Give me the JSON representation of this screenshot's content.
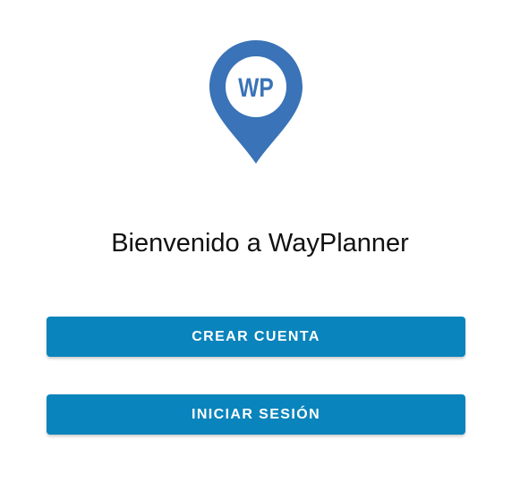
{
  "logo": {
    "text": "WP",
    "icon": "map-pin-icon",
    "color": "#3a73b7"
  },
  "welcome": {
    "title": "Bienvenido a WayPlanner"
  },
  "buttons": {
    "create_account": "CREAR CUENTA",
    "login": "INICIAR SESIÓN",
    "color": "#0a84bc"
  }
}
